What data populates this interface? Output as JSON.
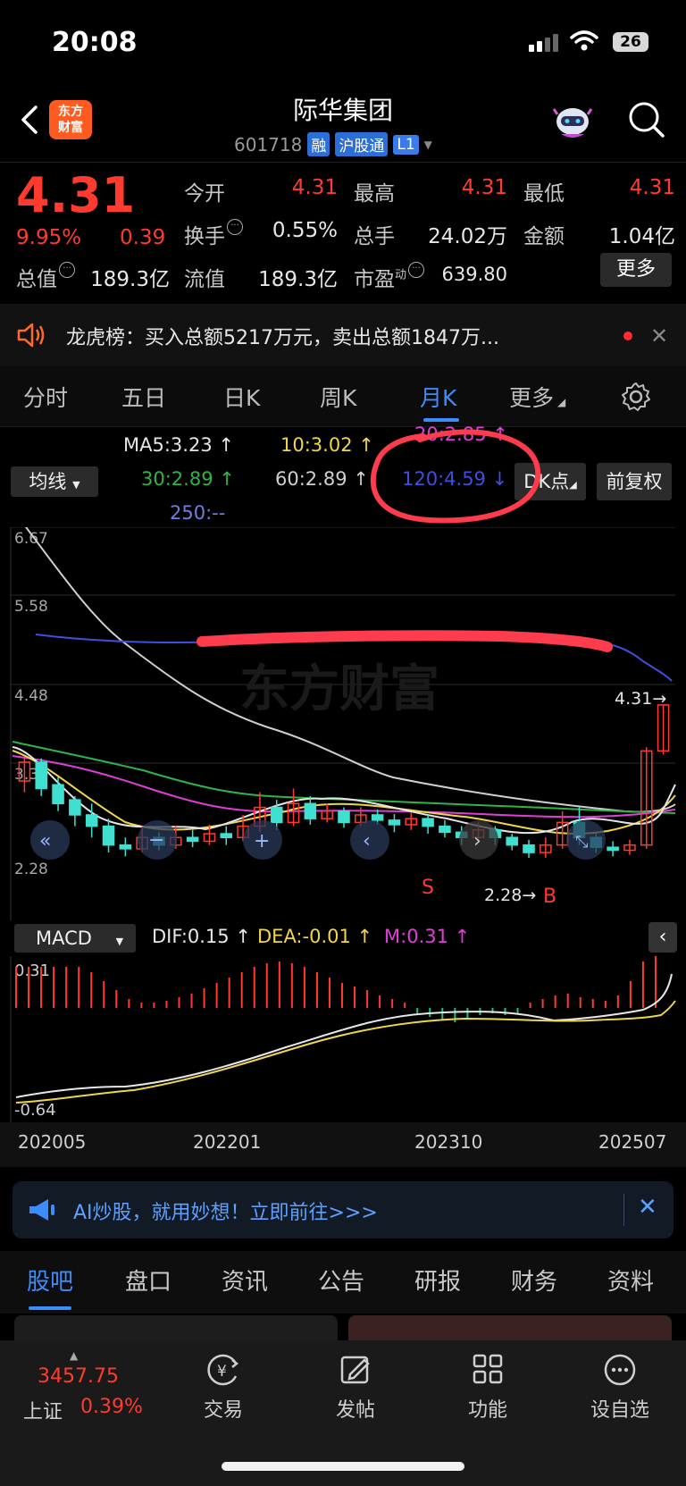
{
  "status": {
    "time": "20:08",
    "battery": "26"
  },
  "header": {
    "title": "际华集团",
    "code": "601718",
    "tags": [
      "融",
      "沪股通",
      "L1"
    ],
    "logo_text": "东方财富"
  },
  "quote": {
    "price": "4.31",
    "change_pct": "9.95%",
    "change": "0.39",
    "fields": {
      "open_label": "今开",
      "open": "4.31",
      "high_label": "最高",
      "high": "4.31",
      "low_label": "最低",
      "low": "4.31",
      "turnover_label": "换手",
      "turnover": "0.55%",
      "volume_label": "总手",
      "volume": "24.02万",
      "amount_label": "金额",
      "amount": "1.04亿",
      "mktcap_label": "总值",
      "mktcap": "189.3亿",
      "float_label": "流值",
      "float": "189.3亿",
      "pe_label": "市盈",
      "pe_sup": "动",
      "pe": "639.80"
    },
    "more_label": "更多"
  },
  "notice": {
    "text": "龙虎榜：买入总额5217万元，卖出总额1847万..."
  },
  "ktabs": {
    "items": [
      "分时",
      "五日",
      "日K",
      "周K",
      "月K",
      "更多"
    ],
    "active": "月K"
  },
  "ma": {
    "selector": "均线",
    "ma5": "MA5:3.23",
    "ma10": "10:3.02",
    "ma20": "20:2.85",
    "ma30": "30:2.89",
    "ma60": "60:2.89",
    "ma120": "120:4.59",
    "ma250": "250:--",
    "dk_label": "DK点",
    "fq_label": "前复权",
    "colors": {
      "ma5": "#e6e6e6",
      "ma10": "#f0d64a",
      "ma20": "#e03ed8",
      "ma30": "#2fb44a",
      "ma60": "#d0d0d0",
      "ma120": "#3f4fe0",
      "ma250": "#6f7fe0"
    }
  },
  "chart_data": {
    "type": "candlestick",
    "y_ticks": [
      "6.67",
      "5.58",
      "4.48",
      "3.38",
      "2.28"
    ],
    "last_price_label": "4.31",
    "low_label": "2.28",
    "signal_labels": [
      "S",
      "B"
    ],
    "x_ticks": [
      "202005",
      "202201",
      "202310",
      "202507"
    ],
    "watermark": "东方财富",
    "candles": [
      [
        3.3,
        3.55,
        3.15,
        3.6
      ],
      [
        3.55,
        3.2,
        3.1,
        3.6
      ],
      [
        3.25,
        3.0,
        2.9,
        3.35
      ],
      [
        3.05,
        2.85,
        2.7,
        3.1
      ],
      [
        2.85,
        2.7,
        2.55,
        3.0
      ],
      [
        2.7,
        2.45,
        2.35,
        2.8
      ],
      [
        2.45,
        2.4,
        2.3,
        2.55
      ],
      [
        2.4,
        2.55,
        2.35,
        2.7
      ],
      [
        2.55,
        2.45,
        2.38,
        2.62
      ],
      [
        2.45,
        2.55,
        2.4,
        2.7
      ],
      [
        2.55,
        2.5,
        2.42,
        2.65
      ],
      [
        2.5,
        2.6,
        2.45,
        2.72
      ],
      [
        2.6,
        2.55,
        2.45,
        2.7
      ],
      [
        2.55,
        2.7,
        2.5,
        2.85
      ],
      [
        2.7,
        2.95,
        2.62,
        3.15
      ],
      [
        2.95,
        2.75,
        2.65,
        3.05
      ],
      [
        2.75,
        3.0,
        2.7,
        3.2
      ],
      [
        3.0,
        2.8,
        2.72,
        3.1
      ],
      [
        2.8,
        2.9,
        2.75,
        3.0
      ],
      [
        2.9,
        2.75,
        2.68,
        2.95
      ],
      [
        2.75,
        2.85,
        2.7,
        2.95
      ],
      [
        2.85,
        2.78,
        2.72,
        2.92
      ],
      [
        2.78,
        2.72,
        2.62,
        2.86
      ],
      [
        2.72,
        2.8,
        2.65,
        2.88
      ],
      [
        2.8,
        2.7,
        2.6,
        2.85
      ],
      [
        2.7,
        2.62,
        2.55,
        2.78
      ],
      [
        2.62,
        2.55,
        2.45,
        2.7
      ],
      [
        2.55,
        2.65,
        2.5,
        2.75
      ],
      [
        2.65,
        2.55,
        2.45,
        2.7
      ],
      [
        2.55,
        2.45,
        2.38,
        2.6
      ],
      [
        2.45,
        2.35,
        2.28,
        2.52
      ],
      [
        2.35,
        2.45,
        2.28,
        2.55
      ],
      [
        2.45,
        2.75,
        2.4,
        2.9
      ],
      [
        2.75,
        2.55,
        2.45,
        2.95
      ],
      [
        2.55,
        2.42,
        2.35,
        2.6
      ],
      [
        2.42,
        2.38,
        2.3,
        2.5
      ],
      [
        2.38,
        2.45,
        2.32,
        2.52
      ],
      [
        2.45,
        3.7,
        2.4,
        3.75
      ],
      [
        3.7,
        4.31,
        3.65,
        4.31
      ]
    ],
    "macd": {
      "top_label": "0.31",
      "bottom_label": "-0.64"
    }
  },
  "macd_bar": {
    "selector": "MACD",
    "dif": "DIF:0.15",
    "dea": "DEA:-0.01",
    "m": "M:0.31",
    "colors": {
      "dif": "#e8e8e8",
      "dea": "#f0d64a",
      "m": "#e03ed8"
    }
  },
  "ai_banner": {
    "text": "AI炒股，就用妙想！立即前往>>>"
  },
  "bottom_tabs": {
    "items": [
      "股吧",
      "盘口",
      "资讯",
      "公告",
      "研报",
      "财务",
      "资料"
    ],
    "active": "股吧"
  },
  "nav": {
    "index_value": "3457.75",
    "index_name": "上证",
    "index_pct": "0.39%",
    "items": [
      "交易",
      "发帖",
      "功能",
      "设自选"
    ]
  },
  "colors": {
    "up": "#ff3b30",
    "down": "#19c37d",
    "accent": "#3b8cff",
    "annotation": "#ff3b4e"
  }
}
